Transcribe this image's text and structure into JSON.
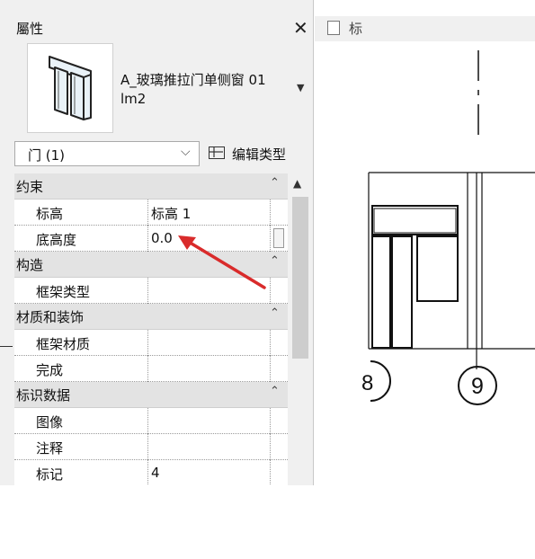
{
  "properties_panel": {
    "title": "屬性",
    "close_icon": "close-icon",
    "type_selector": {
      "name_line1": "A_玻璃推拉门单侧窗 01",
      "name_line2": "lm2",
      "dropdown_icon": "chevron-down-icon"
    },
    "filter": {
      "label": "门 (1)",
      "chevron": "⌵"
    },
    "edit_type_label": "编辑类型",
    "groups": [
      {
        "name": "约束",
        "rows": [
          {
            "name": "标高",
            "value": "标高 1"
          },
          {
            "name": "底高度",
            "value": "0.0"
          }
        ]
      },
      {
        "name": "构造",
        "rows": [
          {
            "name": "框架类型",
            "value": ""
          }
        ]
      },
      {
        "name": "材质和装饰",
        "rows": [
          {
            "name": "框架材质",
            "value": ""
          },
          {
            "name": "完成",
            "value": ""
          }
        ]
      },
      {
        "name": "标识数据",
        "rows": [
          {
            "name": "图像",
            "value": ""
          },
          {
            "name": "注释",
            "value": ""
          },
          {
            "name": "标记",
            "value": "4"
          }
        ]
      }
    ]
  },
  "view_tab": {
    "label": "标"
  },
  "drawing": {
    "grid_label": "9",
    "partial_grid_label": "8"
  },
  "annotation_arrow_color": "#d92b2b"
}
